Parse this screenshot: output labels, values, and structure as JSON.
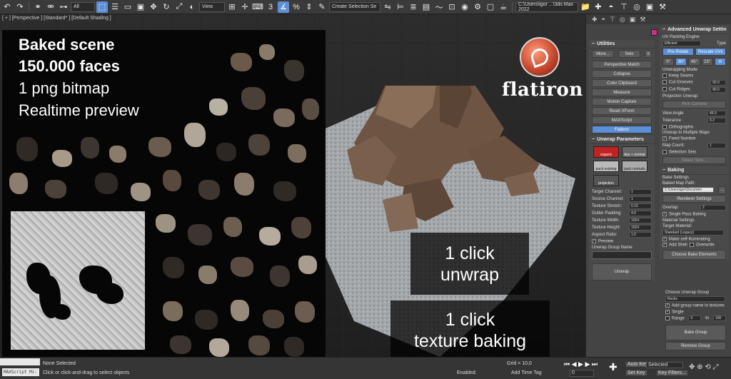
{
  "toolbar": {
    "filter_label": "All",
    "view_label": "View",
    "selection_set_placeholder": "Create Selection Se",
    "project_path": "C:\\Users\\igor ...\\3ds Max 2022"
  },
  "viewport": {
    "label": "[ + ] [Perspective ] [Standard* ] [Default Shading ]",
    "overlay": {
      "line1": "Baked scene",
      "line2": "150.000 faces",
      "line3": "1 png bitmap",
      "line4": "Realtime preview"
    },
    "logo_text": "flatiron",
    "callout_unwrap": {
      "line1": "1 click",
      "line2": "unwrap"
    },
    "callout_bake": {
      "line1": "1 click",
      "line2": "texture baking"
    }
  },
  "utilities": {
    "header": "Utilities",
    "more": "More...",
    "sets": "Sets",
    "items": [
      "Perspective Match",
      "Collapse",
      "Color Clipboard",
      "Measure",
      "Motion Capture",
      "Reset XForm",
      "MAXScript",
      "Flatiron"
    ]
  },
  "unwrap_params": {
    "header": "Unwrap Parameters",
    "presets": [
      "organic",
      "box + normal",
      "pack existing",
      "pack normals",
      "projection"
    ],
    "preview_label": "Preview",
    "fields": [
      {
        "label": "Target Channel:",
        "value": "1"
      },
      {
        "label": "Source Channel:",
        "value": "1"
      },
      {
        "label": "Texture Stretch:",
        "value": "0.15"
      },
      {
        "label": "Gutter Padding:",
        "value": "4.0"
      },
      {
        "label": "Texture Width:",
        "value": "1024"
      },
      {
        "label": "Texture Height:",
        "value": "1024"
      },
      {
        "label": "Aspect Ratio:",
        "value": "1.0"
      }
    ],
    "group_name_label": "Unwrap Group Name",
    "unwrap_button": "Unwrap"
  },
  "adv_unwrap": {
    "header": "Advanced Unwrap Settin",
    "packing_engine_label": "UV Packing Engine",
    "engine_value": "Efficient",
    "type_label": "Type",
    "pre_rotate": "Pre-Rotate",
    "rescale": "Rescale UVs",
    "angles": [
      "0°",
      "30°",
      "45°",
      "23°",
      "⊡"
    ],
    "unwrapping_mode": "Unwrapping Mode",
    "keep_seams": "Keep Seams",
    "cut_grooves": "Cut Grooves",
    "cut_grooves_val": "90.0",
    "cut_ridges": "Cut Ridges",
    "cut_ridges_val": "90.0",
    "projection_unwrap": "Projection Unwrap",
    "pick_camera": "Pick Camera",
    "view_angle": "View Angle",
    "view_angle_val": "45.0",
    "tolerance": "Tolerance",
    "tolerance_val": "0.2",
    "orthographic": "Orthographic",
    "multi_maps": "Unwrap to Multiple Maps",
    "fixed_number": "Fixed Number",
    "map_count": "Map Count:",
    "map_count_val": "1",
    "selection_sets": "Selection Sets",
    "select_sets": "Select Sets..."
  },
  "baking": {
    "header": "Baking",
    "bake_settings": "Bake Settings",
    "baked_map_path": "Baked Map Path:",
    "path_value": "C:\\Users\\igor\\Documen",
    "browse": "...",
    "renderer_settings": "Renderer Settings",
    "overlap": "Overlap:",
    "overlap_val": "2",
    "single_pass": "Single Pass Baking",
    "material_settings": "Material Settings",
    "target_material": "Target Material:",
    "material_value": "Standard (Legacy)",
    "self_illum": "Make self-illuminating",
    "add_shell": "Add Shell",
    "overwrite": "Overwrite",
    "choose_elements": "Choose Bake Elements",
    "choose_group": "Choose Unwrap Group",
    "group_value": "Rocks",
    "add_group_name": "Add group name to textures",
    "single": "Single",
    "range": "Range",
    "range_from": "0",
    "range_to_label": "to",
    "range_to": "100",
    "bake_group": "Bake Group",
    "remove_group": "Remove Group"
  },
  "status": {
    "maxscript": "MAXScript Mi:",
    "none_selected": "None Selected",
    "hint": "Click or click-and-drag to select objects",
    "enabled": "Enabled:",
    "add_time_tag": "Add Time Tag",
    "grid": "Grid = 10,0",
    "auto_key": "Auto Key",
    "set_key": "Set Key",
    "selected": "Selected",
    "key_filters": "Key Filters...",
    "frame": "0"
  }
}
